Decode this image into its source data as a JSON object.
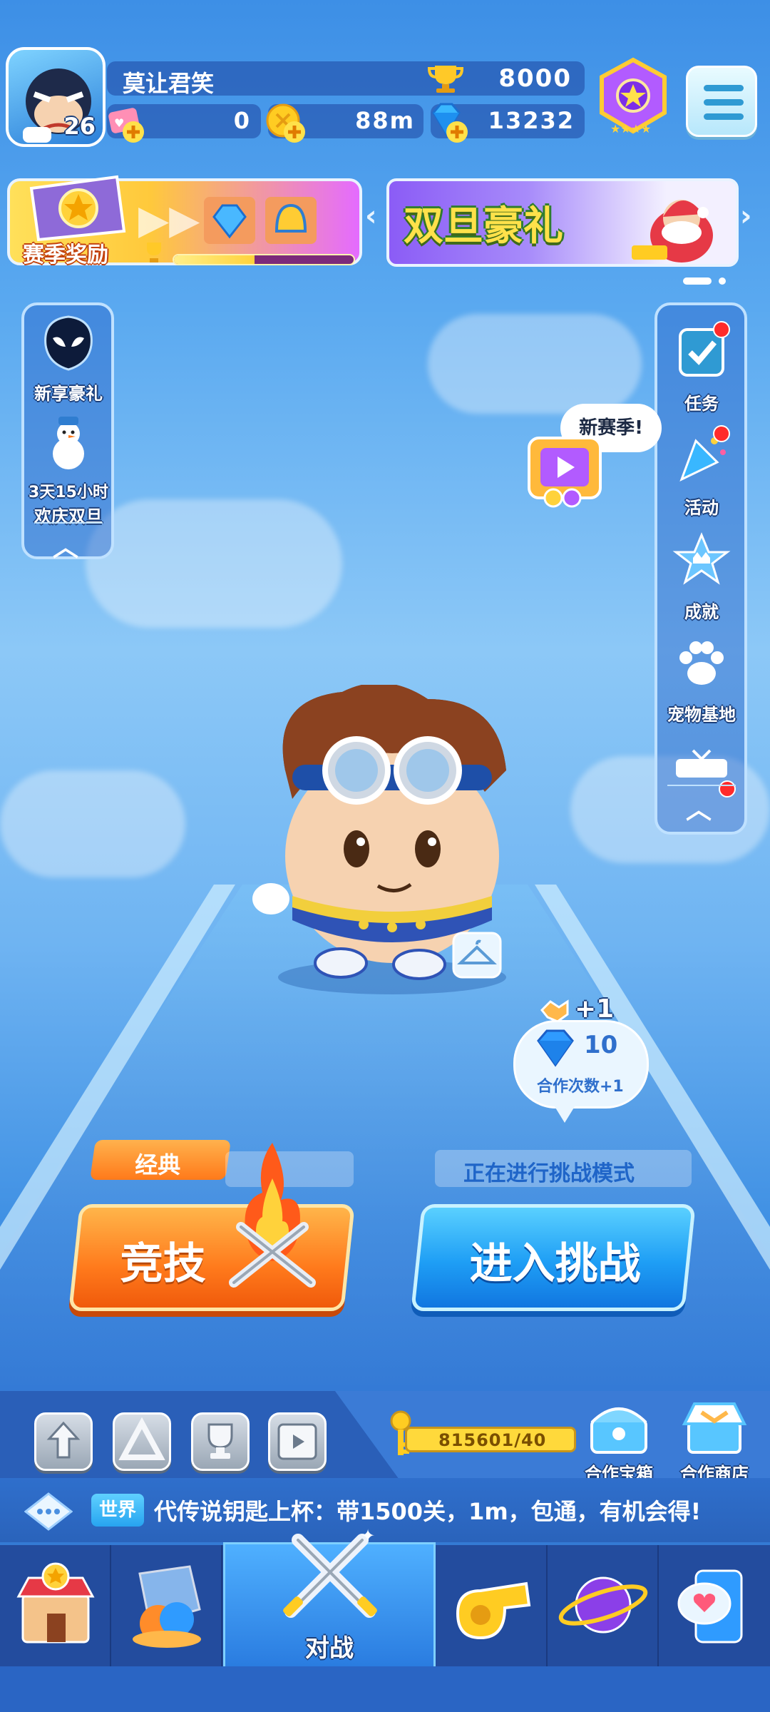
{
  "player": {
    "name": "莫让君笑",
    "level": "26",
    "trophies": "8000",
    "tickets": "0",
    "coins": "88m",
    "gems": "13232"
  },
  "banners": {
    "season_label": "赛季奖励",
    "season_progress": 0.45,
    "holiday_title": "双旦豪礼",
    "prev_arrow": "‹",
    "next_arrow": "›"
  },
  "left_panel": {
    "items": [
      {
        "label": "新享豪礼"
      },
      {
        "label_line1": "3天15小时",
        "label_line2": "欢庆双旦"
      }
    ],
    "collapse": "︿"
  },
  "right_panel": {
    "items": [
      {
        "label": "任务",
        "has_dot": true
      },
      {
        "label": "活动",
        "has_dot": true
      },
      {
        "label": "成就",
        "has_dot": false
      },
      {
        "label": "宠物基地",
        "has_dot": false
      }
    ],
    "collapse": "︿"
  },
  "speech_bubble": "新赛季!",
  "coop": {
    "bonus": "+1",
    "gem_count": "10",
    "label": "合作次数+1"
  },
  "modes": {
    "classic_tag": "经典",
    "challenge_status": "正在进行挑战模式",
    "compete_label": "竞技",
    "enter_label": "进入挑战"
  },
  "toolbar": {
    "key_progress": "815601/40",
    "coop_chest_label": "合作宝箱",
    "coop_shop_label": "合作商店"
  },
  "chat": {
    "channel": "世界",
    "message": "代传说钥匙上杯：带1500关，1m，包通，有机会得!"
  },
  "nav": {
    "active_label": "对战"
  },
  "colors": {
    "accent_orange": "#ff7a1c",
    "accent_blue": "#1e9ef5",
    "notification_red": "#ff2b2b"
  }
}
